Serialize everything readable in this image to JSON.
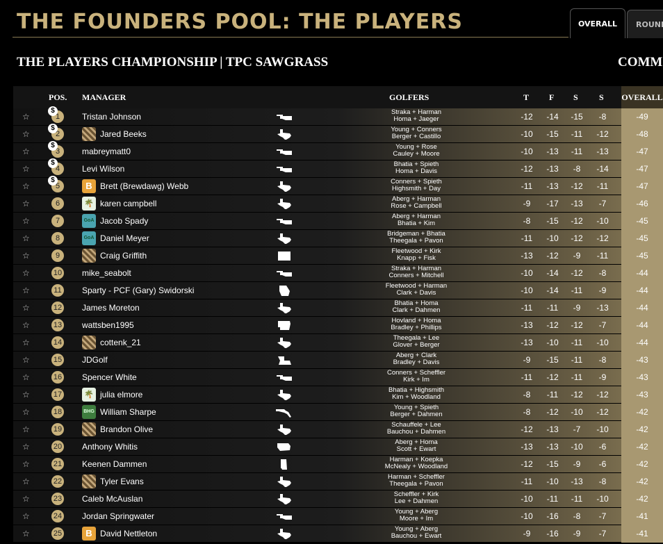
{
  "header": {
    "title": "THE FOUNDERS POOL: THE PLAYERS",
    "tabs": [
      {
        "label": "OVERALL",
        "active": true
      },
      {
        "label": "ROUND"
      }
    ]
  },
  "event": {
    "title": "THE PLAYERS CHAMPIONSHIP | TPC SAWGRASS",
    "side_label": "COMM"
  },
  "table": {
    "columns": {
      "pos": "POS.",
      "manager": "MANAGER",
      "golfers": "GOLFERS",
      "t": "T",
      "f": "F",
      "s1": "S",
      "s2": "S",
      "overall": "OVERALL"
    },
    "rows": [
      {
        "pos": "1",
        "paid": true,
        "avatar": "",
        "manager": "Tristan Johnson",
        "state": "ok",
        "golfers1": "Straka + Harman",
        "golfers2": "Homa + Jaeger",
        "t": "-12",
        "f": "-14",
        "s1": "-15",
        "s2": "-8",
        "overall": "-49"
      },
      {
        "pos": "2",
        "paid": true,
        "avatar": "brown",
        "manager": "Jared Beeks",
        "state": "tx",
        "golfers1": "Young + Conners",
        "golfers2": "Berger + Castillo",
        "t": "-10",
        "f": "-15",
        "s1": "-11",
        "s2": "-12",
        "overall": "-48"
      },
      {
        "pos": "3",
        "paid": true,
        "avatar": "",
        "manager": "mabreymatt0",
        "state": "ok",
        "golfers1": "Young + Rose",
        "golfers2": "Cauley + Moore",
        "t": "-10",
        "f": "-13",
        "s1": "-11",
        "s2": "-13",
        "overall": "-47"
      },
      {
        "pos": "4",
        "paid": true,
        "avatar": "",
        "manager": "Levi Wilson",
        "state": "ok",
        "golfers1": "Bhatia + Spieth",
        "golfers2": "Homa + Davis",
        "t": "-12",
        "f": "-13",
        "s1": "-8",
        "s2": "-14",
        "overall": "-47"
      },
      {
        "pos": "5",
        "paid": true,
        "avatar": "orange",
        "manager": "Brett (Brewdawg) Webb",
        "state": "tx",
        "golfers1": "Conners + Spieth",
        "golfers2": "Highsmith + Day",
        "t": "-11",
        "f": "-13",
        "s1": "-12",
        "s2": "-11",
        "overall": "-47"
      },
      {
        "pos": "6",
        "paid": false,
        "avatar": "green",
        "manager": "karen campbell",
        "state": "tx",
        "golfers1": "Aberg + Harman",
        "golfers2": "Rose + Campbell",
        "t": "-9",
        "f": "-17",
        "s1": "-13",
        "s2": "-7",
        "overall": "-46"
      },
      {
        "pos": "7",
        "paid": false,
        "avatar": "teal",
        "manager": "Jacob Spady",
        "state": "ok",
        "golfers1": "Aberg + Harman",
        "golfers2": "Bhatia + Kim",
        "t": "-8",
        "f": "-15",
        "s1": "-12",
        "s2": "-10",
        "overall": "-45"
      },
      {
        "pos": "8",
        "paid": false,
        "avatar": "teal",
        "manager": "Daniel Meyer",
        "state": "tx",
        "golfers1": "Bridgeman + Bhatia",
        "golfers2": "Theegala + Pavon",
        "t": "-11",
        "f": "-10",
        "s1": "-12",
        "s2": "-12",
        "overall": "-45"
      },
      {
        "pos": "9",
        "paid": false,
        "avatar": "brown",
        "manager": "Craig Griffith",
        "state": "box",
        "golfers1": "Fleetwood + Kirk",
        "golfers2": "Knapp + Fisk",
        "t": "-13",
        "f": "-12",
        "s1": "-9",
        "s2": "-11",
        "overall": "-45"
      },
      {
        "pos": "10",
        "paid": false,
        "avatar": "",
        "manager": "mike_seabolt",
        "state": "ok",
        "golfers1": "Straka + Harman",
        "golfers2": "Conners + Mitchell",
        "t": "-10",
        "f": "-14",
        "s1": "-12",
        "s2": "-8",
        "overall": "-44"
      },
      {
        "pos": "11",
        "paid": false,
        "avatar": "",
        "manager": "Sparty - PCF (Gary) Swidorski",
        "state": "ga",
        "golfers1": "Fleetwood + Harman",
        "golfers2": "Clark + Davis",
        "t": "-10",
        "f": "-14",
        "s1": "-11",
        "s2": "-9",
        "overall": "-44"
      },
      {
        "pos": "12",
        "paid": false,
        "avatar": "",
        "manager": "James Moreton",
        "state": "tx",
        "golfers1": "Bhatia + Homa",
        "golfers2": "Clark + Dahmen",
        "t": "-11",
        "f": "-11",
        "s1": "-9",
        "s2": "-13",
        "overall": "-44"
      },
      {
        "pos": "13",
        "paid": false,
        "avatar": "",
        "manager": "wattsben1995",
        "state": "ar",
        "golfers1": "Hovland + Homa",
        "golfers2": "Bradley + Phillips",
        "t": "-13",
        "f": "-12",
        "s1": "-12",
        "s2": "-7",
        "overall": "-44"
      },
      {
        "pos": "14",
        "paid": false,
        "avatar": "brown",
        "manager": "cottenk_21",
        "state": "tx",
        "golfers1": "Theegala + Lee",
        "golfers2": "Glover + Berger",
        "t": "-13",
        "f": "-10",
        "s1": "-11",
        "s2": "-10",
        "overall": "-44"
      },
      {
        "pos": "15",
        "paid": false,
        "avatar": "",
        "manager": "JDGolf",
        "state": "la",
        "golfers1": "Aberg + Clark",
        "golfers2": "Bradley + Davis",
        "t": "-9",
        "f": "-15",
        "s1": "-11",
        "s2": "-8",
        "overall": "-43"
      },
      {
        "pos": "16",
        "paid": false,
        "avatar": "",
        "manager": "Spencer White",
        "state": "ok",
        "golfers1": "Conners + Scheffler",
        "golfers2": "Kirk + Im",
        "t": "-11",
        "f": "-12",
        "s1": "-11",
        "s2": "-9",
        "overall": "-43"
      },
      {
        "pos": "17",
        "paid": false,
        "avatar": "green",
        "manager": "julia elmore",
        "state": "tx",
        "golfers1": "Bhatia + Highsmith",
        "golfers2": "Kim + Woodland",
        "t": "-8",
        "f": "-11",
        "s1": "-12",
        "s2": "-12",
        "overall": "-43"
      },
      {
        "pos": "18",
        "paid": false,
        "avatar": "darkgreen",
        "manager": "William Sharpe",
        "state": "fl",
        "golfers1": "Young + Spieth",
        "golfers2": "Berger + Dahmen",
        "t": "-8",
        "f": "-12",
        "s1": "-10",
        "s2": "-12",
        "overall": "-42"
      },
      {
        "pos": "19",
        "paid": false,
        "avatar": "brown",
        "manager": "Brandon Olive",
        "state": "tx",
        "golfers1": "Schauffele + Lee",
        "golfers2": "Bauchou + Dahmen",
        "t": "-12",
        "f": "-13",
        "s1": "-7",
        "s2": "-10",
        "overall": "-42"
      },
      {
        "pos": "20",
        "paid": false,
        "avatar": "",
        "manager": "Anthony Whitis",
        "state": "wi",
        "golfers1": "Aberg + Homa",
        "golfers2": "Scott + Ewart",
        "t": "-13",
        "f": "-13",
        "s1": "-10",
        "s2": "-6",
        "overall": "-42"
      },
      {
        "pos": "21",
        "paid": false,
        "avatar": "",
        "manager": "Keenen Dammen",
        "state": "al",
        "golfers1": "Harman + Koepka",
        "golfers2": "McNealy + Woodland",
        "t": "-12",
        "f": "-15",
        "s1": "-9",
        "s2": "-6",
        "overall": "-42"
      },
      {
        "pos": "22",
        "paid": false,
        "avatar": "brown",
        "manager": "Tyler Evans",
        "state": "tx",
        "golfers1": "Harman + Scheffler",
        "golfers2": "Theegala + Pavon",
        "t": "-11",
        "f": "-10",
        "s1": "-13",
        "s2": "-8",
        "overall": "-42"
      },
      {
        "pos": "23",
        "paid": false,
        "avatar": "",
        "manager": "Caleb McAuslan",
        "state": "tx",
        "golfers1": "Scheffler + Kirk",
        "golfers2": "Lee + Dahmen",
        "t": "-10",
        "f": "-11",
        "s1": "-11",
        "s2": "-10",
        "overall": "-42"
      },
      {
        "pos": "24",
        "paid": false,
        "avatar": "",
        "manager": "Jordan Springwater",
        "state": "ok",
        "golfers1": "Young + Aberg",
        "golfers2": "Moore + Im",
        "t": "-10",
        "f": "-16",
        "s1": "-8",
        "s2": "-7",
        "overall": "-41"
      },
      {
        "pos": "25",
        "paid": false,
        "avatar": "orange",
        "manager": "David Nettleton",
        "state": "tx",
        "golfers1": "Young + Aberg",
        "golfers2": "Bauchou + Ewart",
        "t": "-9",
        "f": "-16",
        "s1": "-9",
        "s2": "-7",
        "overall": "-41"
      }
    ]
  },
  "icons": {
    "favorite": "star-icon",
    "paid": "dollar-icon",
    "state": "state-map-icon"
  }
}
